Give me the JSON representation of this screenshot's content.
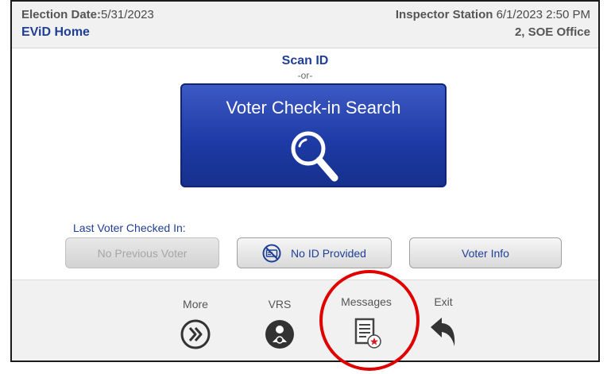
{
  "header": {
    "election_date_label": "Election Date:",
    "election_date_value": "5/31/2023",
    "page_title": "EViD Home",
    "station_label": "Inspector Station",
    "station_datetime": "6/1/2023 2:50 PM",
    "station_location": "2, SOE Office"
  },
  "main": {
    "scan_id": "Scan ID",
    "or_text": "-or-",
    "search_button_label": "Voter Check-in Search",
    "last_voter_label": "Last Voter Checked In:",
    "no_previous_voter": "No Previous Voter",
    "no_id_provided": "No ID Provided",
    "voter_info": "Voter Info"
  },
  "footer": {
    "more": "More",
    "vrs": "VRS",
    "messages": "Messages",
    "exit": "Exit"
  },
  "colors": {
    "accent_blue": "#1f3f96",
    "button_blue": "#1e3ba6",
    "highlight_red": "#e10000"
  },
  "icons": {
    "search": "magnifier-icon",
    "no_id": "no-id-card-icon",
    "more": "double-chevron-right-icon",
    "vrs": "user-sync-icon",
    "messages": "document-star-icon",
    "exit": "back-arrow-icon"
  }
}
